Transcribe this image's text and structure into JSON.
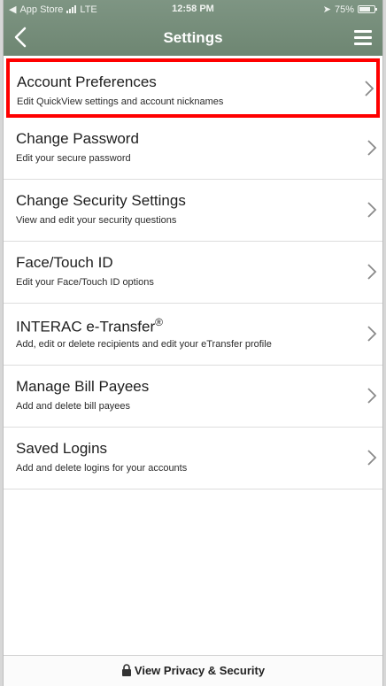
{
  "status_bar": {
    "carrier": "App Store",
    "network": "LTE",
    "time": "12:58 PM",
    "battery": "75%",
    "battery_level": 0.75
  },
  "header": {
    "title": "Settings",
    "back_icon": "chevron-left-icon",
    "menu_icon": "hamburger-menu-icon"
  },
  "items": [
    {
      "title": "Account Preferences",
      "subtitle": "Edit QuickView settings and account nicknames",
      "highlighted": true
    },
    {
      "title": "Change Password",
      "subtitle": "Edit your secure password"
    },
    {
      "title": "Change Security Settings",
      "subtitle": "View and edit your security questions"
    },
    {
      "title": "Face/Touch ID",
      "subtitle": "Edit your Face/Touch ID options"
    },
    {
      "title": "INTERAC e-Transfer",
      "title_sup": "®",
      "subtitle": "Add, edit or delete recipients and edit your eTransfer profile"
    },
    {
      "title": "Manage Bill Payees",
      "subtitle": "Add and delete bill payees"
    },
    {
      "title": "Saved Logins",
      "subtitle": "Add and delete logins for your accounts"
    }
  ],
  "footer": {
    "label": "View Privacy & Security",
    "icon": "lock-icon"
  },
  "colors": {
    "header": "#728a76",
    "highlight": "#ff0000"
  }
}
